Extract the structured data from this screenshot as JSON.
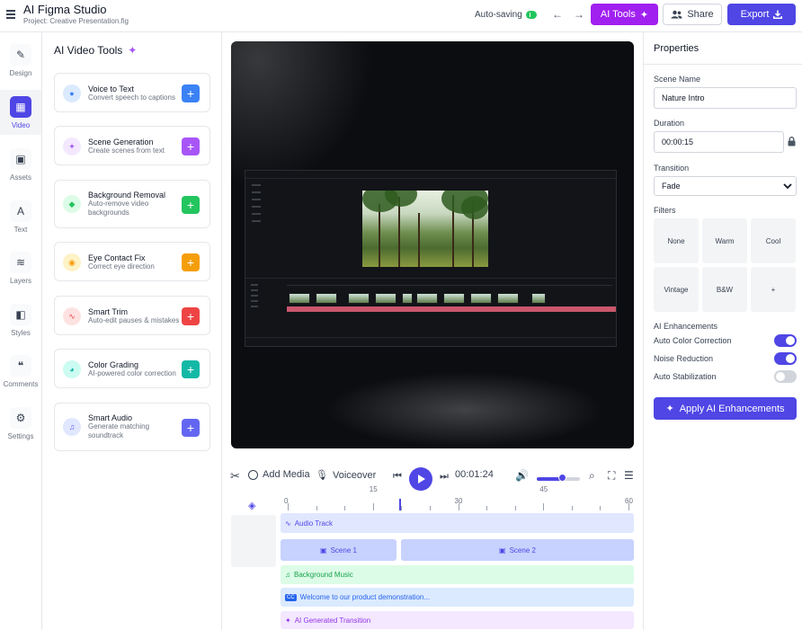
{
  "header": {
    "app_title": "AI Figma Studio",
    "project": "Project: Creative Presentation.fig",
    "autosave": "Auto-saving",
    "ai_tools_label": "AI Tools",
    "share_label": "Share",
    "export_label": "Export"
  },
  "rail": {
    "items": [
      {
        "label": "Design",
        "icon": "design-icon"
      },
      {
        "label": "Video",
        "icon": "video-icon"
      },
      {
        "label": "Assets",
        "icon": "images-icon"
      },
      {
        "label": "Text",
        "icon": "text-icon"
      },
      {
        "label": "Layers",
        "icon": "layers-icon"
      },
      {
        "label": "Styles",
        "icon": "shapes-icon"
      },
      {
        "label": "Comments",
        "icon": "comments-icon"
      },
      {
        "label": "Settings",
        "icon": "gear-icon"
      }
    ],
    "active": "Video"
  },
  "tools": {
    "title": "AI Video Tools",
    "items": [
      {
        "name": "Voice to Text",
        "desc": "Convert speech to captions",
        "icon": "microphone-icon",
        "color": "#3b82f6"
      },
      {
        "name": "Scene Generation",
        "desc": "Create scenes from text",
        "icon": "magic-wand-icon",
        "color": "#a855f7"
      },
      {
        "name": "Background Removal",
        "desc": "Auto-remove video backgrounds",
        "icon": "eraser-icon",
        "color": "#22c55e"
      },
      {
        "name": "Eye Contact Fix",
        "desc": "Correct eye direction",
        "icon": "eye-icon",
        "color": "#f59e0b"
      },
      {
        "name": "Smart Trim",
        "desc": "Auto-edit pauses & mistakes",
        "icon": "waveform-icon",
        "color": "#ef4444"
      },
      {
        "name": "Color Grading",
        "desc": "AI-powered color correction",
        "icon": "palette-icon",
        "color": "#14b8a6"
      },
      {
        "name": "Smart Audio",
        "desc": "Generate matching soundtrack",
        "icon": "music-icon",
        "color": "#6366f1"
      }
    ]
  },
  "playbar": {
    "add_media": "Add Media",
    "voiceover": "Voiceover",
    "timecode": "00:01:24",
    "volume": 0.6
  },
  "timeline": {
    "ticks": [
      "0",
      "15",
      "30",
      "45",
      "60"
    ],
    "tracks": {
      "audio": "Audio Track",
      "scene1": "Scene 1",
      "scene2": "Scene 2",
      "music": "Background Music",
      "caption": "Welcome to our product demonstration...",
      "transition": "AI Generated Transition"
    }
  },
  "properties": {
    "title": "Properties",
    "scene_name_label": "Scene Name",
    "scene_name": "Nature Intro",
    "duration_label": "Duration",
    "duration": "00:00:15",
    "transition_label": "Transition",
    "transition": "Fade",
    "filters_label": "Filters",
    "filters": [
      "None",
      "Warm",
      "Cool",
      "Vintage",
      "B&W",
      "+"
    ],
    "enhancements_label": "AI Enhancements",
    "enhancements": [
      {
        "label": "Auto Color Correction",
        "on": true
      },
      {
        "label": "Noise Reduction",
        "on": true
      },
      {
        "label": "Auto Stabilization",
        "on": false
      }
    ],
    "apply_label": "Apply AI Enhancements"
  },
  "colors": {
    "primary": "#4f46e5",
    "ai_purple": "#a020f0"
  }
}
